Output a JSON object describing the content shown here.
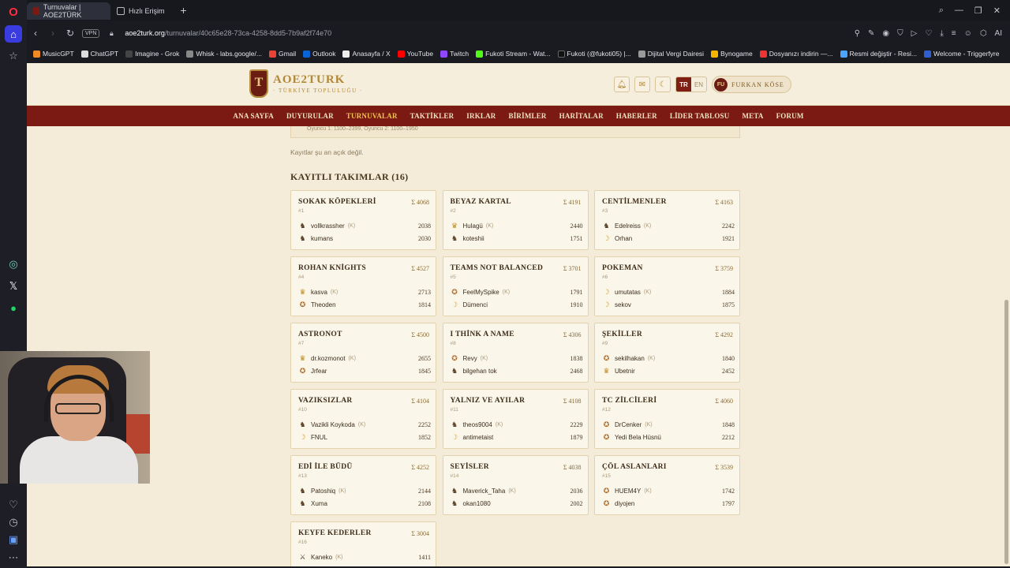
{
  "browser": {
    "tabs": [
      {
        "label": "Turnuvalar | AOE2TÜRK",
        "active": true
      },
      {
        "label": "Hızlı Erişim",
        "active": false
      }
    ],
    "url_domain": "aoe2turk.org",
    "url_path": "/turnuvalar/40c65e28-73ca-4258-8dd5-7b9af2f74e70",
    "vpn_label": "VPN",
    "bookmarks": [
      "MusicGPT",
      "ChatGPT",
      "Imagine - Grok",
      "Whisk - labs.google/...",
      "Gmail",
      "Outlook",
      "Anasayfa / X",
      "YouTube",
      "Twitch",
      "Fukoti Stream - Wat...",
      "Fukoti (@fukoti05) |...",
      "Dijital Vergi Dairesi",
      "Bynogame",
      "Dosyanızı indirin —...",
      "Resmi değiştir - Resi...",
      "Welcome - Triggerfyre"
    ]
  },
  "site": {
    "logo_text": "AOE2TURK",
    "logo_sub": "· TÜRKİYE TOPLULUĞU ·",
    "lang_tr": "TR",
    "lang_en": "EN",
    "user_initials": "FU",
    "user_name": "FURKAN KÖSE",
    "nav": [
      "ANA SAYFA",
      "DUYURULAR",
      "TURNUVALAR",
      "TAKTİKLER",
      "IRKLAR",
      "BİRİMLER",
      "HARİTALAR",
      "HABERLER",
      "LİDER TABLOSU",
      "META",
      "FORUM"
    ],
    "nav_active": "TURNUVALAR"
  },
  "content": {
    "notice_partial": "Oyuncu 1: 1100–2399, Oyuncu 2: 1100–1950",
    "registration_status": "Kayıtlar şu an açık değil.",
    "section_title": "KAYITLI TAKIMLAR (16)",
    "teams": [
      {
        "name": "SOKAK KÖPEKLERİ",
        "sum": "Σ 4068",
        "rank": "#1",
        "players": [
          {
            "icon": "horse",
            "name": "vollkrassher",
            "captain": "(K)",
            "elo": "2038"
          },
          {
            "icon": "horse",
            "name": "kumans",
            "captain": "",
            "elo": "2030"
          }
        ]
      },
      {
        "name": "BEYAZ KARTAL",
        "sum": "Σ 4191",
        "rank": "#2",
        "players": [
          {
            "icon": "crown",
            "name": "Hulagü",
            "captain": "(K)",
            "elo": "2440"
          },
          {
            "icon": "horse",
            "name": "koteshii",
            "captain": "",
            "elo": "1751"
          }
        ]
      },
      {
        "name": "CENTİLMENLER",
        "sum": "Σ 4163",
        "rank": "#3",
        "players": [
          {
            "icon": "horse",
            "name": "Edelreiss",
            "captain": "(K)",
            "elo": "2242"
          },
          {
            "icon": "banana",
            "name": "Orhan",
            "captain": "",
            "elo": "1921"
          }
        ]
      },
      {
        "name": "ROHAN KNİGHTS",
        "sum": "Σ 4527",
        "rank": "#4",
        "players": [
          {
            "icon": "crown",
            "name": "kasva",
            "captain": "(K)",
            "elo": "2713"
          },
          {
            "icon": "medal",
            "name": "Theoden",
            "captain": "",
            "elo": "1814"
          }
        ]
      },
      {
        "name": "TEAMS NOT BALANCED",
        "sum": "Σ 3701",
        "rank": "#5",
        "players": [
          {
            "icon": "medal",
            "name": "FeelMySpike",
            "captain": "(K)",
            "elo": "1791"
          },
          {
            "icon": "banana",
            "name": "Dümenci",
            "captain": "",
            "elo": "1910"
          }
        ]
      },
      {
        "name": "POKEMAN",
        "sum": "Σ 3759",
        "rank": "#6",
        "players": [
          {
            "icon": "banana",
            "name": "umutatas",
            "captain": "(K)",
            "elo": "1884"
          },
          {
            "icon": "banana",
            "name": "sekov",
            "captain": "",
            "elo": "1875"
          }
        ]
      },
      {
        "name": "ASTRONOT",
        "sum": "Σ 4500",
        "rank": "#7",
        "players": [
          {
            "icon": "crown",
            "name": "dr.kozmonot",
            "captain": "(K)",
            "elo": "2655"
          },
          {
            "icon": "medal",
            "name": "Jrfear",
            "captain": "",
            "elo": "1845"
          }
        ]
      },
      {
        "name": "I THİNK A NAME",
        "sum": "Σ 4306",
        "rank": "#8",
        "players": [
          {
            "icon": "medal",
            "name": "Revy",
            "captain": "(K)",
            "elo": "1838"
          },
          {
            "icon": "horse",
            "name": "bilgehan tok",
            "captain": "",
            "elo": "2468"
          }
        ]
      },
      {
        "name": "ŞEKİLLER",
        "sum": "Σ 4292",
        "rank": "#9",
        "players": [
          {
            "icon": "medal",
            "name": "sekilhakan",
            "captain": "(K)",
            "elo": "1840"
          },
          {
            "icon": "crown",
            "name": "Ubetnir",
            "captain": "",
            "elo": "2452"
          }
        ]
      },
      {
        "name": "VAZIKSIZLAR",
        "sum": "Σ 4104",
        "rank": "#10",
        "players": [
          {
            "icon": "horse",
            "name": "Vazikli Koykoda",
            "captain": "(K)",
            "elo": "2252"
          },
          {
            "icon": "banana",
            "name": "FNUL",
            "captain": "",
            "elo": "1852"
          }
        ]
      },
      {
        "name": "YALNIZ VE AYILAR",
        "sum": "Σ 4108",
        "rank": "#11",
        "players": [
          {
            "icon": "horse",
            "name": "theos9004",
            "captain": "(K)",
            "elo": "2229"
          },
          {
            "icon": "banana",
            "name": "antimetaist",
            "captain": "",
            "elo": "1879"
          }
        ]
      },
      {
        "name": "TC ZİLCİLERİ",
        "sum": "Σ 4060",
        "rank": "#12",
        "players": [
          {
            "icon": "medal",
            "name": "DrCenker",
            "captain": "(K)",
            "elo": "1848"
          },
          {
            "icon": "medal",
            "name": "Yedi Bela Hüsnü",
            "captain": "",
            "elo": "2212"
          }
        ]
      },
      {
        "name": "EDİ İLE BÜDÜ",
        "sum": "Σ 4252",
        "rank": "#13",
        "players": [
          {
            "icon": "horse",
            "name": "Patoshiq",
            "captain": "(K)",
            "elo": "2144"
          },
          {
            "icon": "horse",
            "name": "Xuma",
            "captain": "",
            "elo": "2108"
          }
        ]
      },
      {
        "name": "SEYİSLER",
        "sum": "Σ 4038",
        "rank": "#14",
        "players": [
          {
            "icon": "horse",
            "name": "Maverick_Taha",
            "captain": "(K)",
            "elo": "2036"
          },
          {
            "icon": "horse",
            "name": "okan1080",
            "captain": "",
            "elo": "2002"
          }
        ]
      },
      {
        "name": "ÇÖL ASLANLARI",
        "sum": "Σ 3539",
        "rank": "#15",
        "players": [
          {
            "icon": "medal",
            "name": "HUEM4Y",
            "captain": "(K)",
            "elo": "1742"
          },
          {
            "icon": "medal",
            "name": "diyojen",
            "captain": "",
            "elo": "1797"
          }
        ]
      },
      {
        "name": "KEYFE KEDERLER",
        "sum": "Σ 3004",
        "rank": "#16",
        "players": [
          {
            "icon": "swords",
            "name": "Kaneko",
            "captain": "(K)",
            "elo": "1411"
          },
          {
            "icon": "horse",
            "name": "",
            "captain": "",
            "elo": ""
          }
        ]
      }
    ]
  },
  "colors": {
    "nav_bg": "#7a1a12",
    "nav_active": "#f0c453",
    "page_bg": "#f4ecd9",
    "card_bg": "#fbf6ea",
    "gold": "#b08838"
  }
}
